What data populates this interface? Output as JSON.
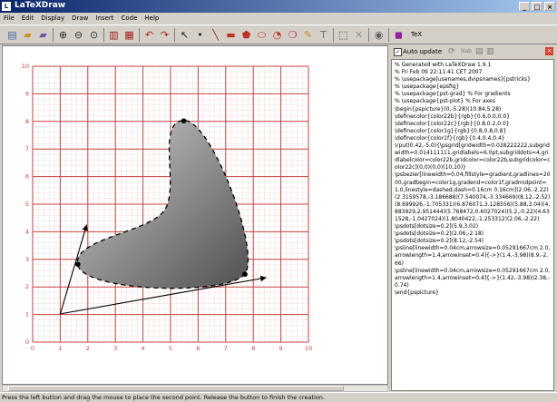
{
  "window": {
    "title": "LaTeXDraw",
    "controls": [
      "_",
      "□",
      "×"
    ]
  },
  "menu": [
    "File",
    "Edit",
    "Display",
    "Draw",
    "Insert",
    "Code",
    "Help"
  ],
  "toolbar": [
    {
      "name": "new-doc-icon",
      "glyph": "▤",
      "color": "#4a6fa5"
    },
    {
      "name": "open-folder-icon",
      "glyph": "▰",
      "color": "#c89020"
    },
    {
      "name": "save-icon",
      "glyph": "▰",
      "color": "#7050a0"
    },
    {
      "name": "sep"
    },
    {
      "name": "zoom-in-icon",
      "glyph": "⊕",
      "color": "#303030"
    },
    {
      "name": "zoom-out-icon",
      "glyph": "⊖",
      "color": "#303030"
    },
    {
      "name": "zoom-default-icon",
      "glyph": "⊙",
      "color": "#303030"
    },
    {
      "name": "sep"
    },
    {
      "name": "copy-icon",
      "glyph": "▥",
      "color": "#a02020"
    },
    {
      "name": "paste-icon",
      "glyph": "▦",
      "color": "#a02020"
    },
    {
      "name": "sep"
    },
    {
      "name": "undo-icon",
      "glyph": "↶",
      "color": "#b02020"
    },
    {
      "name": "redo-icon",
      "glyph": "↷",
      "color": "#b02020"
    },
    {
      "name": "sep"
    },
    {
      "name": "select-arrow-icon",
      "glyph": "↖",
      "color": "#202020"
    },
    {
      "name": "dot-tool-icon",
      "glyph": "•",
      "color": "#202020"
    },
    {
      "name": "line-tool-icon",
      "glyph": "╲",
      "color": "#a02020"
    },
    {
      "name": "rectangle-tool-icon",
      "glyph": "▬",
      "color": "#c03020"
    },
    {
      "name": "polygon-tool-icon",
      "glyph": "⬟",
      "color": "#c03020"
    },
    {
      "name": "ellipse-tool-icon",
      "glyph": "⬭",
      "color": "#c03020"
    },
    {
      "name": "arc-tool-icon",
      "glyph": "◔",
      "color": "#c03020"
    },
    {
      "name": "bezier-tool-icon",
      "glyph": "❍",
      "color": "#c03060"
    },
    {
      "name": "freehand-tool-icon",
      "glyph": "✎",
      "color": "#c09020"
    },
    {
      "name": "text-tool-icon",
      "glyph": "T",
      "color": "#707070"
    },
    {
      "name": "sep"
    },
    {
      "name": "selection-rect-icon",
      "glyph": "⬚",
      "color": "#303030"
    },
    {
      "name": "delete-icon",
      "glyph": "✕",
      "color": "#909090"
    },
    {
      "name": "sep"
    },
    {
      "name": "grid-icon",
      "glyph": "◉",
      "color": "#606060"
    },
    {
      "name": "sep"
    },
    {
      "name": "latex-insert-icon",
      "glyph": "◼",
      "color": "#9020a0"
    }
  ],
  "toolbar_extra_label": "TeX",
  "code_panel": {
    "auto_update_label": "Auto update",
    "checked": "✓",
    "icons": [
      {
        "name": "refresh-icon",
        "glyph": "⟳"
      },
      {
        "name": "nab-label",
        "glyph": "Nab"
      },
      {
        "name": "copy-code-icon",
        "glyph": "▤"
      },
      {
        "name": "copy-selection-icon",
        "glyph": "▥"
      }
    ],
    "close": "×",
    "code": "% Generated with LaTeXDraw 1.9.1\n% Fri Feb 09 22:11:41 CET 2007\n% \\usepackage[usenames,dvipsnames]{pstricks}\n% \\usepackage{epsfig}\n% \\usepackage{pst-grad} % For gradients\n% \\usepackage{pst-plot} % For axes\n\\begin{pspicture}(0,-5.28)(10.84,5.28)\n\\definecolor{color22b}{rgb}{0.6,0.0,0.0}\n\\definecolor{color22c}{rgb}{0.8,0.2,0.0}\n\\definecolor{color1g}{rgb}{0.8,0.8,0.8}\n\\definecolor{color1f}{rgb}{0.4,0.4,0.4}\n\\rput(0.42,-5.0){\\psgrid[gridwidth=0.028222222,subgridwidth=0.014111111,gridlabels=6.0pt,subgriddots=4,gridlabelcolor=color22b,gridcolor=color22b,subgridcolor=color22c](0,0)(0,0)(10,10)}\n\\psbezier[linewidth=0.04,fillstyle=gradient,gradlines=2000,gradbegin=color1g,gradend=color1f,gradmidpoint=1.0,linestyle=dashed,dash=0.16cm 0.16cm](2.06,-2.22)(2.3159578,-3.186688)(7.540074,-3.334669)(8.12,-2.52)(8.699926,-1.705331)(6.876071,3.128556)(5.88,3.04)(4.883929,2.951444)(5.768472,0.6027024)(5.2,-0.22)(4.631528,-1.0427024)(1.8040422,-1.253312)(2.06,-2.22)\n\\psdots[dotsize=0.2](5.9,3.02)\n\\psdots[dotsize=0.2](2.06,-2.18)\n\\psdots[dotsize=0.2](8.12,-2.54)\n\\psline[linewidth=0.04cm,arrowsize=0.05291667cm 2.0,arrowlength=1.4,arrowinset=0.4]{->}(1.4,-3.98)(8.9,-2.66)\n\\psline[linewidth=0.04cm,arrowsize=0.05291667cm 2.0,arrowlength=1.4,arrowinset=0.4]{->}(1.42,-3.98)(2.38,-0.74)\n\\end{pspicture}"
  },
  "canvas": {
    "x_tick_labels": [
      "0",
      "1",
      "2",
      "3",
      "4",
      "5",
      "6",
      "7",
      "8",
      "9",
      "10"
    ],
    "y_tick_labels": [
      "0",
      "1",
      "2",
      "3",
      "4",
      "5",
      "6",
      "7",
      "8",
      "9",
      "10"
    ],
    "grid_color": "#c84040",
    "subgrid_color": "#e0a0a0",
    "label_color": "#c84040",
    "gradient_start": "#d0d0d0",
    "gradient_end": "#505050"
  },
  "status": "Press the left button and drag the mouse to place the second point. Release the button to finish the creation."
}
